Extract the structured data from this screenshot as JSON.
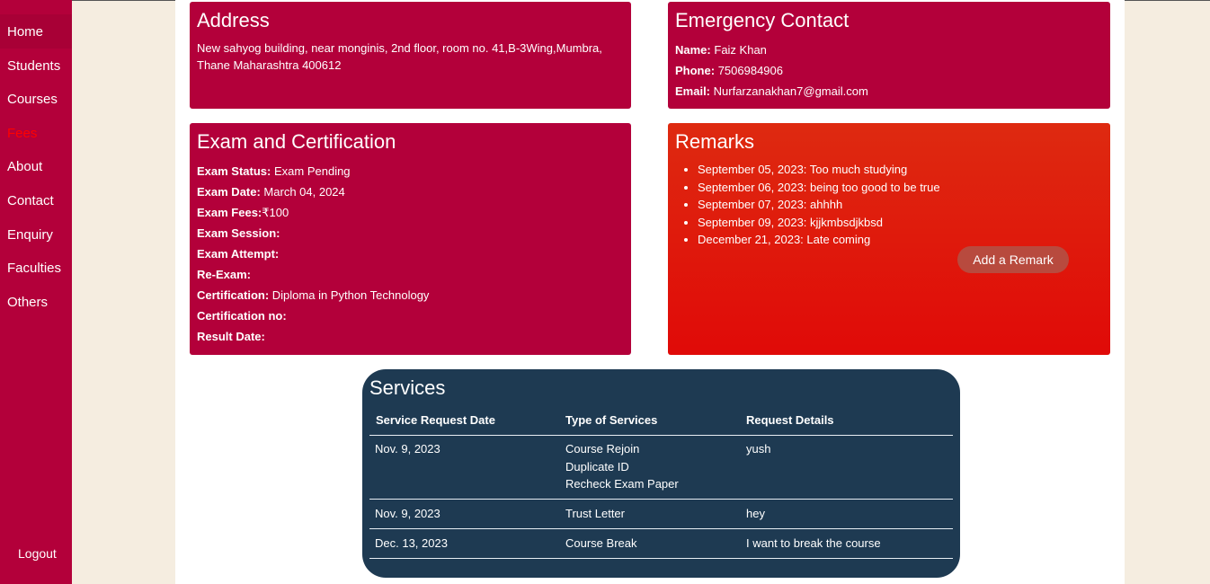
{
  "sidebar": {
    "items": [
      {
        "label": "Home"
      },
      {
        "label": "Students"
      },
      {
        "label": "Courses"
      },
      {
        "label": "Fees"
      },
      {
        "label": "About"
      },
      {
        "label": "Contact"
      },
      {
        "label": "Enquiry"
      },
      {
        "label": "Faculties"
      },
      {
        "label": "Others"
      }
    ],
    "logout": "Logout"
  },
  "address": {
    "title": "Address",
    "text": "New sahyog building, near monginis, 2nd floor, room no. 41,B-3Wing,Mumbra, Thane Maharashtra 400612"
  },
  "emergency": {
    "title": "Emergency Contact",
    "name_label": "Name:",
    "name": "Faiz Khan",
    "phone_label": "Phone:",
    "phone": "7506984906",
    "email_label": "Email:",
    "email": "Nurfarzanakhan7@gmail.com"
  },
  "exam": {
    "title": "Exam and Certification",
    "rows": [
      {
        "label": "Exam Status:",
        "value": " Exam Pending"
      },
      {
        "label": "Exam Date:",
        "value": " March 04, 2024"
      },
      {
        "label": "Exam Fees:",
        "value": "₹100"
      },
      {
        "label": "Exam Session:",
        "value": ""
      },
      {
        "label": "Exam Attempt:",
        "value": ""
      },
      {
        "label": "Re-Exam:",
        "value": ""
      },
      {
        "label": "Certification:",
        "value": " Diploma in Python Technology"
      },
      {
        "label": "Certification no:",
        "value": ""
      },
      {
        "label": "Result Date:",
        "value": ""
      }
    ]
  },
  "remarks": {
    "title": "Remarks",
    "items": [
      "September 05, 2023: Too much studying",
      "September 06, 2023: being too good to be true",
      "September 07, 2023: ahhhh",
      "September 09, 2023: kjjkmbsdjkbsd",
      "December 21, 2023: Late coming"
    ],
    "add_button": "Add a Remark"
  },
  "services": {
    "title": "Services",
    "headers": [
      "Service Request Date",
      "Type of Services",
      "Request Details"
    ],
    "rows": [
      {
        "date": "Nov. 9, 2023",
        "types": [
          "Course Rejoin",
          "Duplicate ID",
          "Recheck Exam Paper"
        ],
        "details": "yush"
      },
      {
        "date": "Nov. 9, 2023",
        "types": [
          "Trust Letter"
        ],
        "details": "hey"
      },
      {
        "date": "Dec. 13, 2023",
        "types": [
          "Course Break"
        ],
        "details": "I want to break the course"
      }
    ]
  },
  "colors": {
    "sidebar": "#b3003a",
    "card": "#b3003a",
    "remarks_top": "#de2a10",
    "remarks_bottom": "#e00a08",
    "services": "#1e3a52",
    "active_nav": "#ff0000",
    "page_bg": "#f5ede0"
  }
}
